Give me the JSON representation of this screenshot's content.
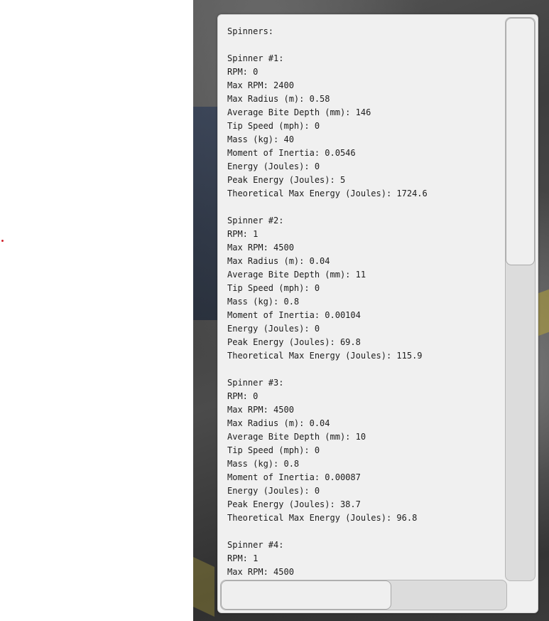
{
  "panel": {
    "heading": "Spinners:",
    "spinners": [
      {
        "title": "Spinner #1:",
        "rpm": "RPM: 0",
        "max_rpm": "Max RPM: 2400",
        "max_radius": "Max Radius (m): 0.58",
        "avg_bite_depth": "Average Bite Depth (mm): 146",
        "tip_speed": "Tip Speed (mph): 0",
        "mass": "Mass (kg): 40",
        "moment_of_inertia": "Moment of Inertia: 0.0546",
        "energy": "Energy (Joules): 0",
        "peak_energy": "Peak Energy (Joules): 5",
        "theoretical_max_energy": "Theoretical Max Energy (Joules): 1724.6"
      },
      {
        "title": "Spinner #2:",
        "rpm": "RPM: 1",
        "max_rpm": "Max RPM: 4500",
        "max_radius": "Max Radius (m): 0.04",
        "avg_bite_depth": "Average Bite Depth (mm): 11",
        "tip_speed": "Tip Speed (mph): 0",
        "mass": "Mass (kg): 0.8",
        "moment_of_inertia": "Moment of Inertia: 0.00104",
        "energy": "Energy (Joules): 0",
        "peak_energy": "Peak Energy (Joules): 69.8",
        "theoretical_max_energy": "Theoretical Max Energy (Joules): 115.9"
      },
      {
        "title": "Spinner #3:",
        "rpm": "RPM: 0",
        "max_rpm": "Max RPM: 4500",
        "max_radius": "Max Radius (m): 0.04",
        "avg_bite_depth": "Average Bite Depth (mm): 10",
        "tip_speed": "Tip Speed (mph): 0",
        "mass": "Mass (kg): 0.8",
        "moment_of_inertia": "Moment of Inertia: 0.00087",
        "energy": "Energy (Joules): 0",
        "peak_energy": "Peak Energy (Joules): 38.7",
        "theoretical_max_energy": "Theoretical Max Energy (Joules): 96.8"
      },
      {
        "title": "Spinner #4:",
        "rpm": "RPM: 1",
        "max_rpm": "Max RPM: 4500"
      }
    ]
  },
  "scroll": {
    "vertical_position": 0.0,
    "vertical_visible_fraction": 0.44,
    "horizontal_position": 0.0,
    "horizontal_visible_fraction": 0.6
  },
  "colors": {
    "panel_bg": "#f0f0f0",
    "text": "#1c1c1c",
    "scrollbar_track": "#dcdcdc",
    "scrollbar_thumb": "#efefef",
    "marker_dot": "#d0202a"
  }
}
